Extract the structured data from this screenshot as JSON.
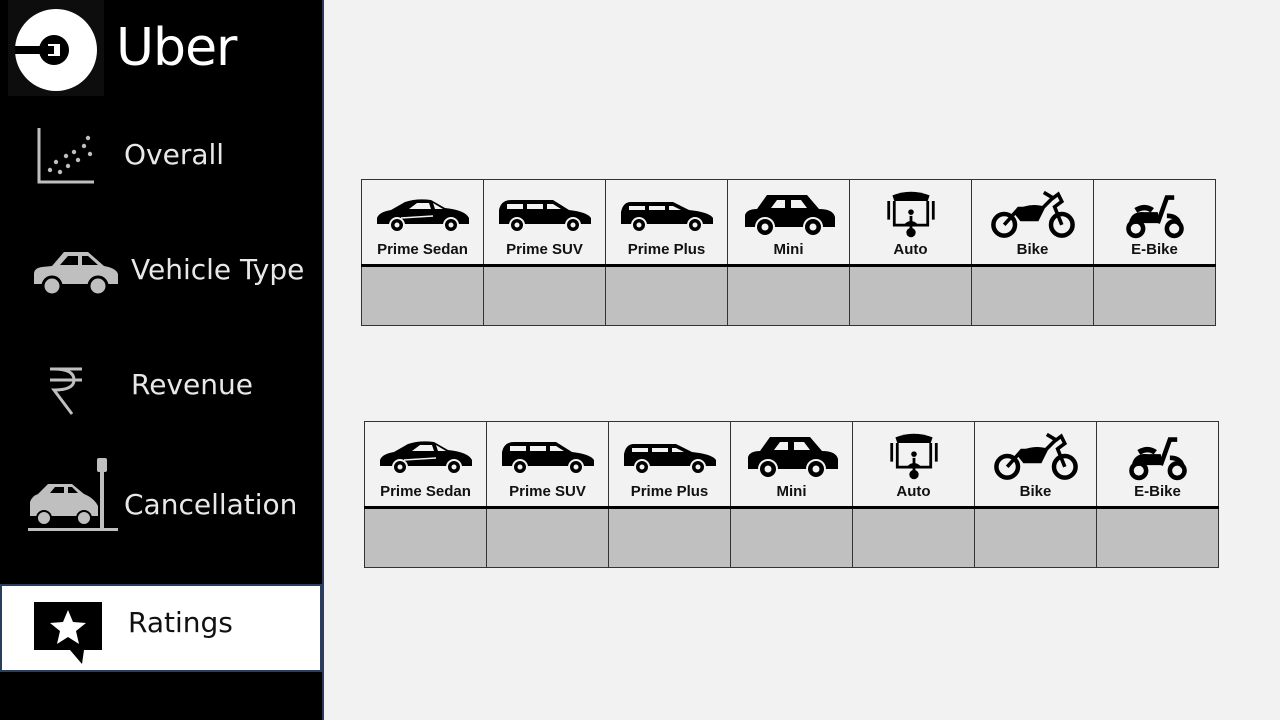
{
  "app": {
    "brand": "Uber"
  },
  "sidebar": {
    "items": [
      {
        "label": "Overall",
        "icon": "scatter-chart-icon",
        "active": false
      },
      {
        "label": "Vehicle Type",
        "icon": "car-icon",
        "active": false
      },
      {
        "label": "Revenue",
        "icon": "rupee-icon",
        "active": false
      },
      {
        "label": "Cancellation",
        "icon": "car-crash-icon",
        "active": false
      },
      {
        "label": "Ratings",
        "icon": "star-comment-icon",
        "active": true
      }
    ]
  },
  "colors": {
    "sidebar_bg": "#000000",
    "active_bg": "#ffffff",
    "content_bg": "#f2f2f2",
    "value_cell_bg": "#c0c0c0"
  },
  "tables": [
    {
      "vehicles": [
        {
          "label": "Prime Sedan",
          "icon": "sedan-icon"
        },
        {
          "label": "Prime SUV",
          "icon": "suv-icon"
        },
        {
          "label": "Prime Plus",
          "icon": "hatchback-icon"
        },
        {
          "label": "Mini",
          "icon": "mini-car-icon"
        },
        {
          "label": "Auto",
          "icon": "auto-rickshaw-icon"
        },
        {
          "label": "Bike",
          "icon": "motorbike-icon"
        },
        {
          "label": "E-Bike",
          "icon": "scooter-icon"
        }
      ],
      "values": [
        "",
        "",
        "",
        "",
        "",
        "",
        ""
      ]
    },
    {
      "vehicles": [
        {
          "label": "Prime Sedan",
          "icon": "sedan-icon"
        },
        {
          "label": "Prime SUV",
          "icon": "suv-icon"
        },
        {
          "label": "Prime Plus",
          "icon": "hatchback-icon"
        },
        {
          "label": "Mini",
          "icon": "mini-car-icon"
        },
        {
          "label": "Auto",
          "icon": "auto-rickshaw-icon"
        },
        {
          "label": "Bike",
          "icon": "motorbike-icon"
        },
        {
          "label": "E-Bike",
          "icon": "scooter-icon"
        }
      ],
      "values": [
        "",
        "",
        "",
        "",
        "",
        "",
        ""
      ]
    }
  ]
}
